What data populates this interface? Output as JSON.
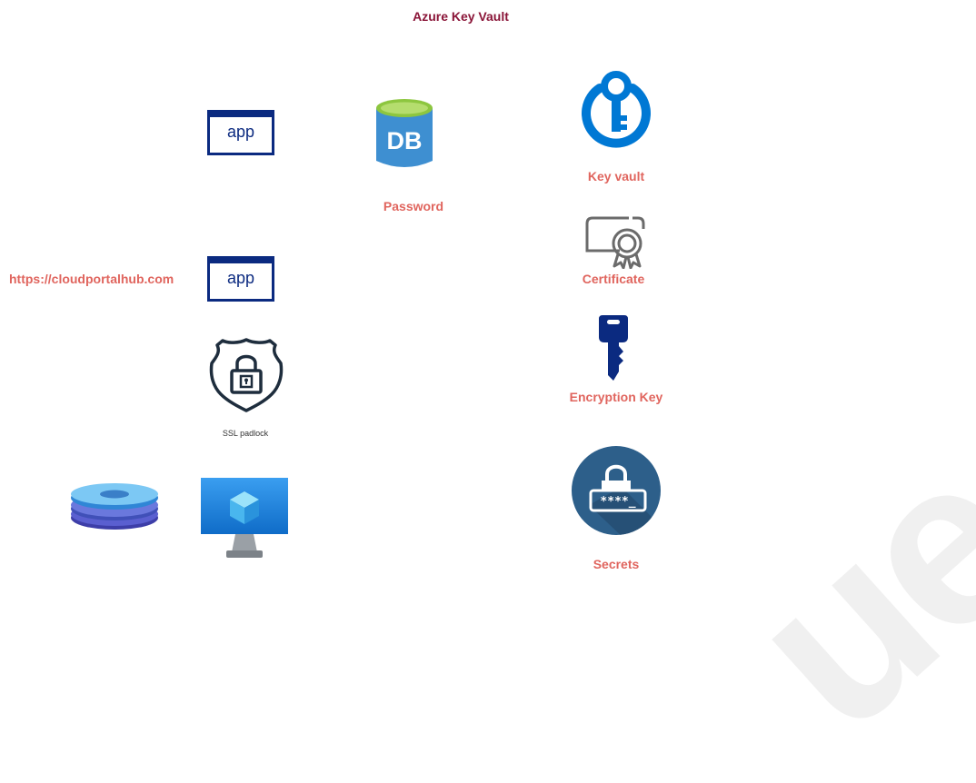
{
  "title": "Azure Key Vault",
  "apps": [
    {
      "label": "app"
    },
    {
      "label": "app"
    }
  ],
  "url_label": "https://cloudportalhub.com",
  "db": {
    "icon": "database-icon",
    "text": "DB",
    "label": "Password"
  },
  "ssl": {
    "icon": "shield-padlock-icon",
    "label": "SSL padlock"
  },
  "storage_icon": "disk-stack-icon",
  "vm_icon": "virtual-machine-icon",
  "key_vault": {
    "icon": "key-vault-icon",
    "label": "Key vault"
  },
  "certificate": {
    "icon": "certificate-icon",
    "label": "Certificate"
  },
  "encryption_key": {
    "icon": "key-icon",
    "label": "Encryption Key"
  },
  "secrets": {
    "icon": "password-lock-icon",
    "text": "****_",
    "label": "Secrets"
  },
  "watermark": "ues",
  "colors": {
    "title": "#8a1538",
    "label": "#e0655e",
    "app_border": "#0b2a80",
    "azure_blue": "#0078d4",
    "db_green": "#8dc63f",
    "secrets_circle": "#2d5f8a"
  }
}
